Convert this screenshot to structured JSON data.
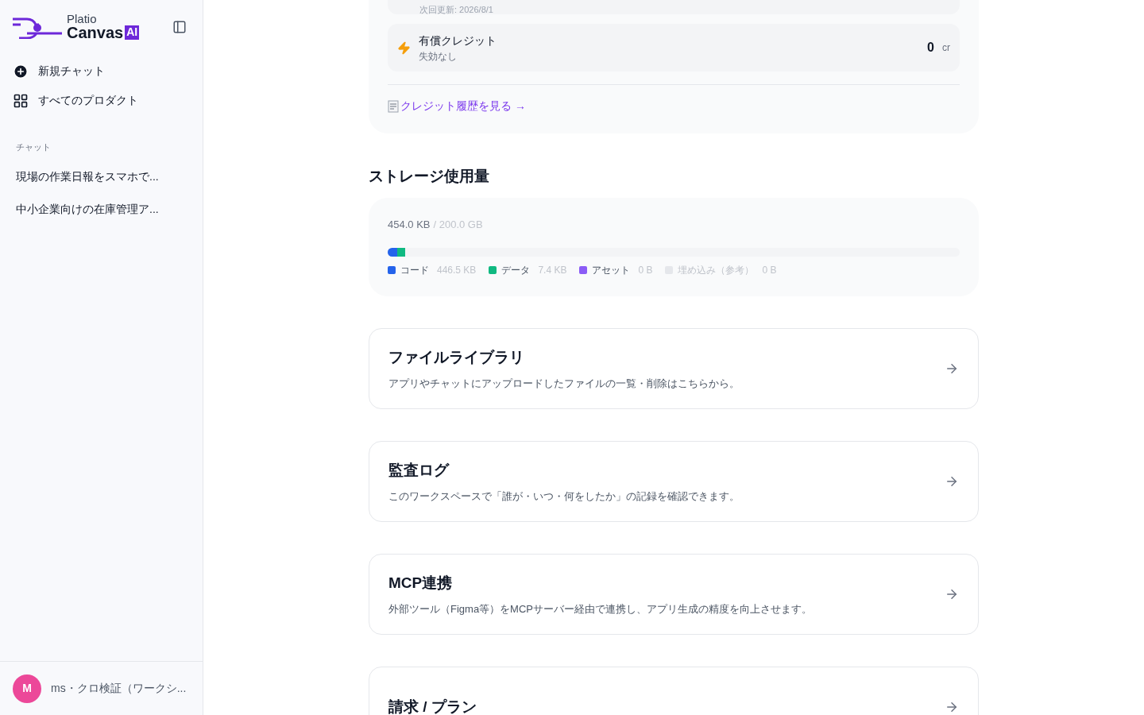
{
  "sidebar": {
    "logo": {
      "top": "Platio",
      "main": "Canvas",
      "badge": "AI"
    },
    "nav": [
      {
        "kind": "new",
        "label": "新規チャット"
      },
      {
        "kind": "grid",
        "label": "すべてのプロダクト"
      }
    ],
    "section_label": "チャット",
    "chats": [
      "現場の作業日報をスマホで...",
      "中小企業向けの在庫管理ア..."
    ],
    "user": {
      "initial": "M",
      "name": "ms・クロ検証（ワークシ..."
    }
  },
  "credits": {
    "renewal": "次回更新: 2026/8/1",
    "paid": {
      "title": "有償クレジット",
      "subtitle": "失効なし",
      "amount": "0",
      "unit": "cr"
    },
    "history_link": "クレジット履歴を見る →"
  },
  "storage": {
    "title": "ストレージ使用量",
    "used": "454.0 KB",
    "total": "/ 200.0 GB",
    "segments": [
      {
        "label": "コード",
        "size": "446.5 KB",
        "color": "#2563eb",
        "level": 0.017,
        "disabled": false
      },
      {
        "label": "データ",
        "size": "7.4 KB",
        "color": "#10b981",
        "level": 0.013,
        "disabled": false
      },
      {
        "label": "アセット",
        "size": "0 B",
        "color": "#8b5cf6",
        "disabled": false
      },
      {
        "label": "埋め込み（参考）",
        "size": "0 B",
        "color": "#e5e7eb",
        "disabled": true
      }
    ]
  },
  "cards": [
    {
      "title": "ファイルライブラリ",
      "description": "アプリやチャットにアップロードしたファイルの一覧・削除はこちらから。"
    },
    {
      "title": "監査ログ",
      "description": "このワークスペースで「誰が・いつ・何をしたか」の記録を確認できます。"
    },
    {
      "title": "MCP連携",
      "description": "外部ツール（Figma等）をMCPサーバー経由で連携し、アプリ生成の精度を向上させます。"
    },
    {
      "title": "請求 / プラン"
    }
  ]
}
